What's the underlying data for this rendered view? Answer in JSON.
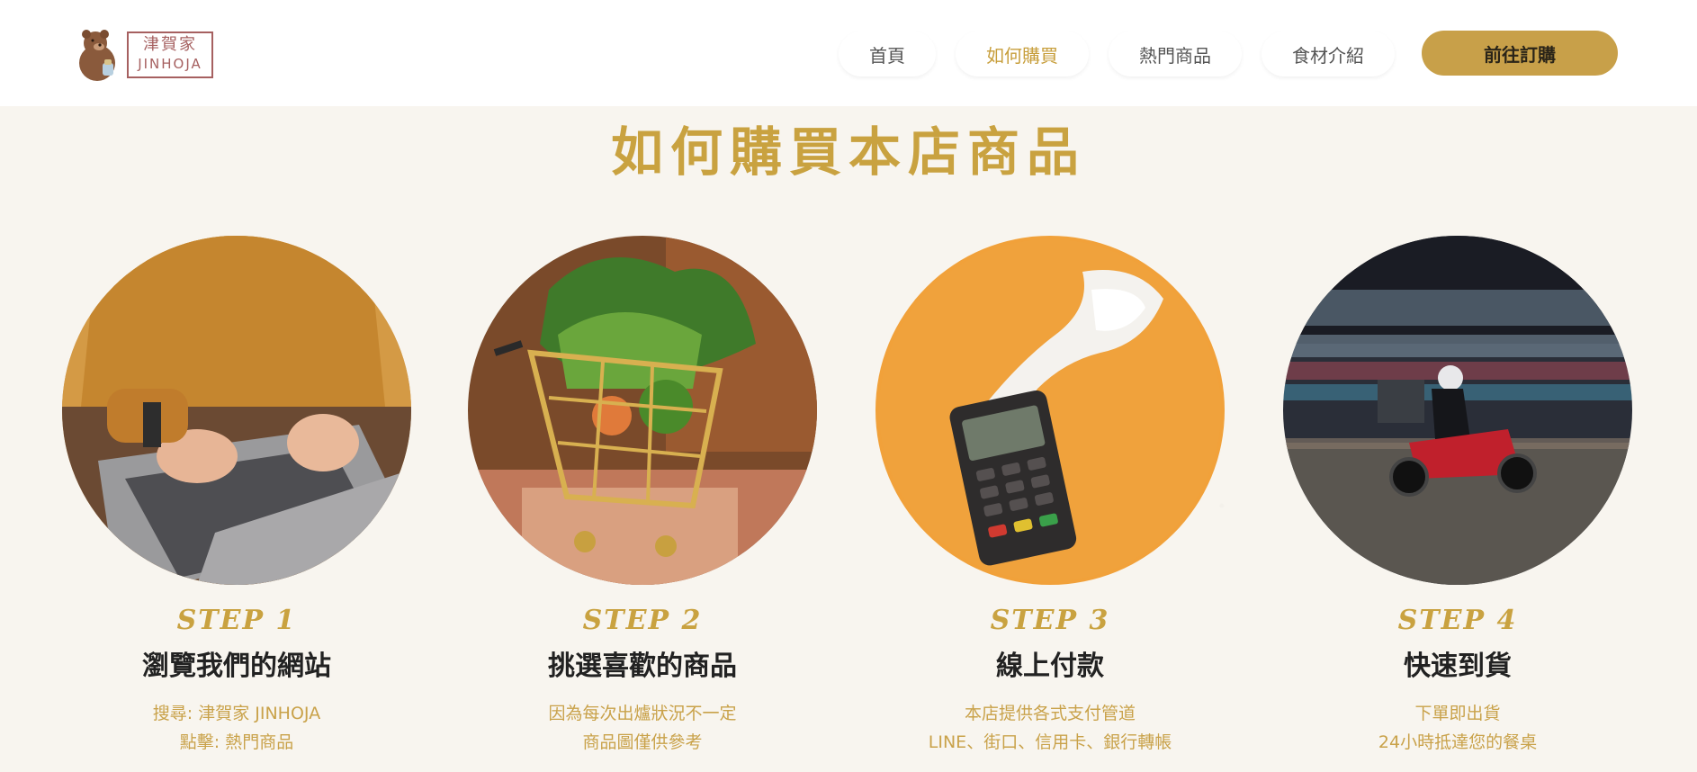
{
  "brand": {
    "name_cn": "津賀家",
    "name_en": "JINHOJA",
    "mascot_icon": "bear-icon"
  },
  "nav": {
    "items": [
      {
        "label": "首頁",
        "active": false
      },
      {
        "label": "如何購買",
        "active": true
      },
      {
        "label": "熱門商品",
        "active": false
      },
      {
        "label": "食材介紹",
        "active": false
      }
    ],
    "cta_label": "前往訂購"
  },
  "section": {
    "title": "如何購買本店商品"
  },
  "steps": [
    {
      "step": "STEP 1",
      "title": "瀏覽我們的網站",
      "desc_line1": "搜尋: 津賀家 JINHOJA",
      "desc_line2": "點擊: 熱門商品",
      "image": "laptop-typing-photo"
    },
    {
      "step": "STEP 2",
      "title": "挑選喜歡的商品",
      "desc_line1": "因為每次出爐狀況不一定",
      "desc_line2": "商品圖僅供參考",
      "image": "vegetable-cart-photo"
    },
    {
      "step": "STEP 3",
      "title": "線上付款",
      "desc_line1": "本店提供各式支付管道",
      "desc_line2": "LINE、街口、信用卡、銀行轉帳",
      "image": "card-terminal-photo"
    },
    {
      "step": "STEP 4",
      "title": "快速到貨",
      "desc_line1": "下單即出貨",
      "desc_line2": "24小時抵達您的餐桌",
      "image": "delivery-scooter-photo"
    }
  ],
  "colors": {
    "accent": "#c9a240",
    "cta_bg": "#c8a049",
    "logo": "#a66060",
    "text": "#222222"
  }
}
